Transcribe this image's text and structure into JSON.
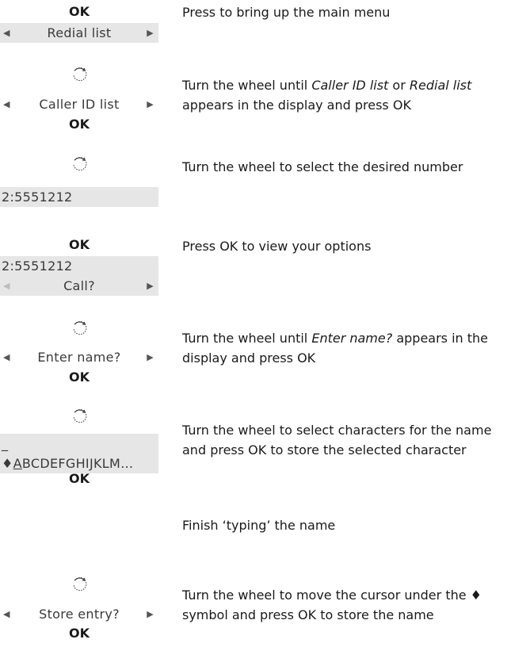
{
  "ok_label": "OK",
  "steps": [
    {
      "instruction": "Press to bring up the main menu",
      "display_text": "Redial list"
    },
    {
      "instruction_pre": "Turn the wheel until ",
      "instruction_em1": "Caller ID list",
      "instruction_mid": " or ",
      "instruction_em2": "Redial list",
      "instruction_line2": "appears in the display and press OK",
      "display_text": "Caller ID list"
    },
    {
      "instruction": "Turn the wheel to select the desired number",
      "display_text": "2:5551212"
    },
    {
      "instruction": "Press OK to view your options",
      "display_line1": "2:5551212",
      "display_line2": "Call?"
    },
    {
      "instruction_pre": "Turn the wheel until ",
      "instruction_em": "Enter name?",
      "instruction_post": " appears in the",
      "instruction_line2": "display and press OK",
      "display_text": "Enter name?"
    },
    {
      "instruction_line1": "Turn the wheel to select characters for the name",
      "instruction_line2": "and press OK to store the selected character",
      "display_line1": "_",
      "display_symbol": "♦",
      "display_selected_char": "A",
      "display_rest": "BCDEFGHIJKLM…"
    },
    {
      "instruction": "Finish ‘typing’ the name"
    },
    {
      "instruction_line1": "Turn the wheel to move the cursor under the ♦",
      "instruction_line2": "symbol and press OK to store the name",
      "display_text": "Store entry?"
    }
  ],
  "icons": {
    "wheel": "wheel-icon",
    "arrow_left": "arrow-left-icon",
    "arrow_right": "arrow-right-icon"
  }
}
